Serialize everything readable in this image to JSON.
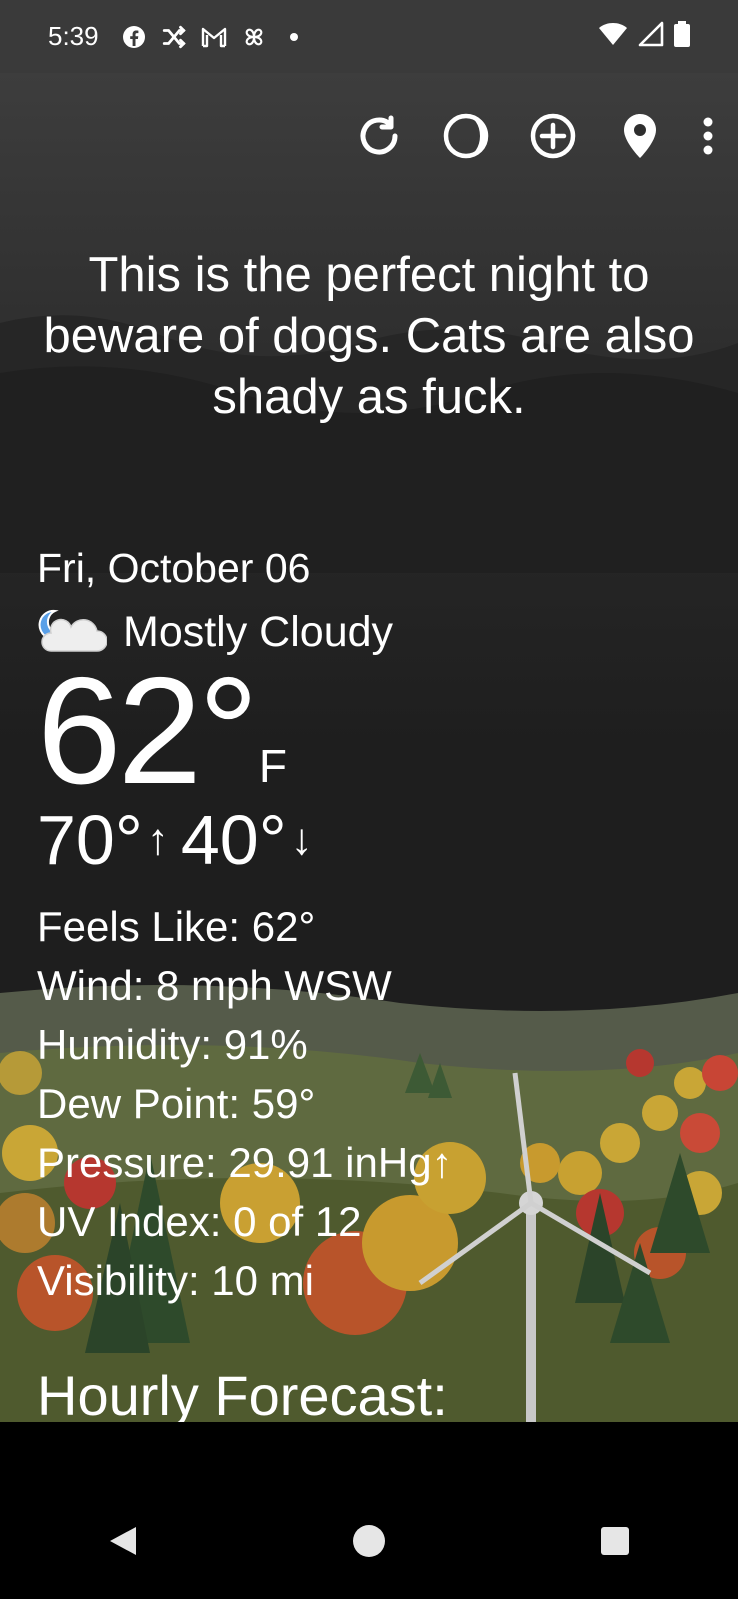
{
  "status": {
    "time": "5:39",
    "left_icons": [
      "facebook-icon",
      "shuffle-icon",
      "gmail-icon",
      "pinwheel-icon",
      "dot-icon"
    ],
    "right_icons": [
      "wifi-icon",
      "signal-icon",
      "battery-icon"
    ]
  },
  "toolbar": {
    "buttons": [
      "refresh-icon",
      "theme-icon",
      "add-location-icon",
      "location-pin-icon",
      "more-vert-icon"
    ]
  },
  "quote": "This is the perfect night to beware of dogs. Cats are also shady as fuck.",
  "weather": {
    "date": "Fri, October 06",
    "condition": "Mostly Cloudy",
    "condition_icon": "moon-cloud-icon",
    "temperature": "62°",
    "unit": "F",
    "high": "70°",
    "low": "40°",
    "details": {
      "feels_like": "Feels Like:  62°",
      "wind": "Wind:  8 mph WSW",
      "humidity": "Humidity:  91%",
      "dew_point": "Dew Point:  59°",
      "pressure": "Pressure:  29.91 inHg↑",
      "uv_index": "UV Index:  0 of 12",
      "visibility": "Visibility:  10 mi"
    },
    "hourly_heading": "Hourly Forecast:"
  },
  "colors": {
    "status_bg": "#3a3a3a",
    "app_bg": "#1f1f1f",
    "grass": "#6d7a3a",
    "tree_green": "#2f4a2a",
    "tree_red": "#b23a2a",
    "tree_yellow": "#d4a52a"
  },
  "nav": [
    "back-icon",
    "home-icon",
    "recents-icon"
  ]
}
